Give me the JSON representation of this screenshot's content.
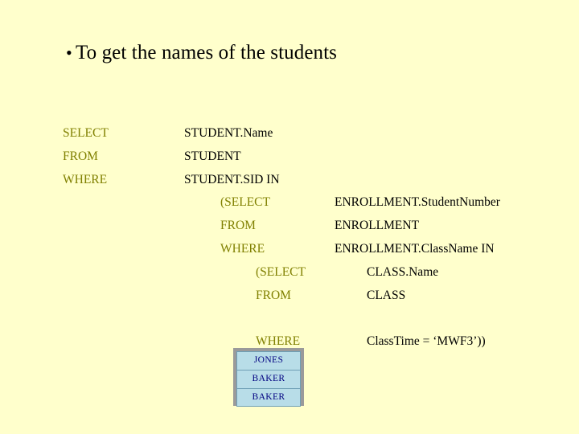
{
  "slide": {
    "background_color": "#ffffcc",
    "keyword_color": "#808000",
    "value_color": "#000000",
    "result_cell_color": "#b8dde8",
    "result_text_color": "#000080",
    "bullet_glyph": "•",
    "title": "To get the names of the students"
  },
  "query": {
    "lines": [
      {
        "level": 1,
        "keyword": "SELECT",
        "value": "STUDENT.Name"
      },
      {
        "level": 1,
        "keyword": "FROM",
        "value": "STUDENT"
      },
      {
        "level": 1,
        "keyword": "WHERE",
        "value": "STUDENT.SID IN"
      },
      {
        "level": 2,
        "keyword": "(SELECT",
        "value": "ENROLLMENT.StudentNumber"
      },
      {
        "level": 2,
        "keyword": "FROM",
        "value": "ENROLLMENT"
      },
      {
        "level": 2,
        "keyword": "WHERE",
        "value": "ENROLLMENT.ClassName IN"
      },
      {
        "level": 3,
        "keyword": "(SELECT",
        "value": "CLASS.Name"
      },
      {
        "level": 3,
        "keyword": "FROM",
        "value": "CLASS"
      },
      {
        "level": 3,
        "keyword": "WHERE",
        "value": "ClassTime = ‘MWF3’))"
      }
    ],
    "line_0_kw": "SELECT",
    "line_0_val": "STUDENT.Name",
    "line_1_kw": "FROM",
    "line_1_val": "STUDENT",
    "line_2_kw": "WHERE",
    "line_2_val": "STUDENT.SID IN",
    "line_3_kw": "(SELECT",
    "line_3_val": "ENROLLMENT.StudentNumber",
    "line_4_kw": "FROM",
    "line_4_val": "ENROLLMENT",
    "line_5_kw": "WHERE",
    "line_5_val": "ENROLLMENT.ClassName IN",
    "line_6_kw": "(SELECT",
    "line_6_val": "CLASS.Name",
    "line_7_kw": "FROM",
    "line_7_val": "CLASS",
    "line_8_kw": "WHERE",
    "line_8_val": "ClassTime = ‘MWF3’))"
  },
  "result": {
    "rows": [
      "JONES",
      "BAKER",
      "BAKER"
    ],
    "row_0": "JONES",
    "row_1": "BAKER",
    "row_2": "BAKER"
  }
}
